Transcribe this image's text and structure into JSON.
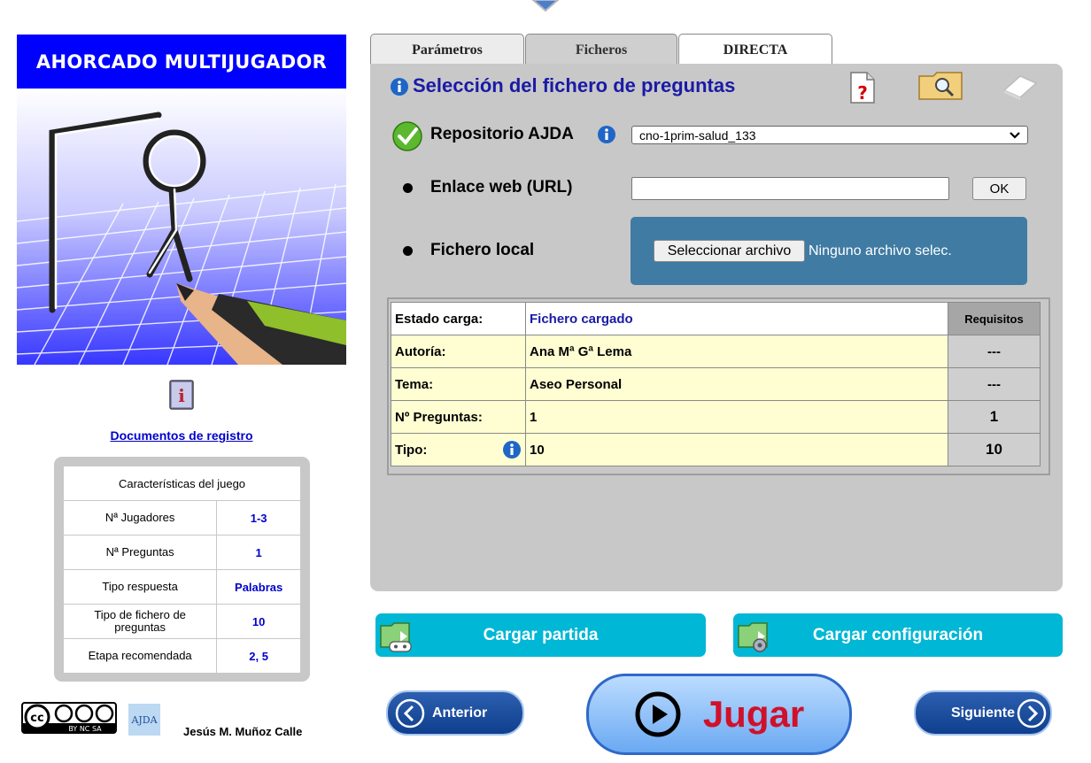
{
  "app_title": "AHORCADO MULTIJUGADOR",
  "sidebar": {
    "docs_link": "Documentos de registro",
    "characteristics": {
      "header": "Características del juego",
      "rows": [
        {
          "label": "Nª Jugadores",
          "value": "1-3"
        },
        {
          "label": "Nª Preguntas",
          "value": "1"
        },
        {
          "label": "Tipo respuesta",
          "value": "Palabras"
        },
        {
          "label": "Tipo de fichero de preguntas",
          "value": "10"
        },
        {
          "label": "Etapa recomendada",
          "value": "2, 5"
        }
      ]
    },
    "author": "Jesús M. Muñoz Calle",
    "cc_text": "BY NC SA",
    "ajda_logo_text": "AJDA"
  },
  "tabs": [
    {
      "label": "Parámetros"
    },
    {
      "label": "Ficheros"
    },
    {
      "label": "DIRECTA"
    }
  ],
  "main": {
    "section_title": "Selección del fichero de preguntas",
    "repo": {
      "label": "Repositorio AJDA",
      "selected": "cno-1prim-salud_133"
    },
    "url": {
      "label": "Enlace web (URL)",
      "value": "",
      "ok_label": "OK"
    },
    "local": {
      "label": "Fichero local",
      "button_label": "Seleccionar archivo",
      "status_text": "Ninguno archivo selec."
    },
    "status_table": {
      "rows": [
        {
          "label": "Estado carga:",
          "value": "Fichero cargado",
          "req": "Requisitos"
        },
        {
          "label": "Autoría:",
          "value": "Ana Mª Gª Lema",
          "req": "---"
        },
        {
          "label": "Tema:",
          "value": "Aseo Personal",
          "req": "---"
        },
        {
          "label": "Nº Preguntas:",
          "value": "1",
          "req": "1"
        },
        {
          "label": "Tipo:",
          "value": "10",
          "req": "10"
        }
      ]
    }
  },
  "actions": {
    "load_game": "Cargar partida",
    "load_config": "Cargar configuración"
  },
  "nav": {
    "prev": "Anterior",
    "play": "Jugar",
    "next": "Siguiente"
  },
  "colors": {
    "banner_blue": "#0000ff",
    "link_blue": "#0000cc",
    "panel_gray": "#c8c8c8",
    "action_cyan": "#00b7d6",
    "play_red": "#d0112b",
    "file_box": "#3f7ba3"
  }
}
